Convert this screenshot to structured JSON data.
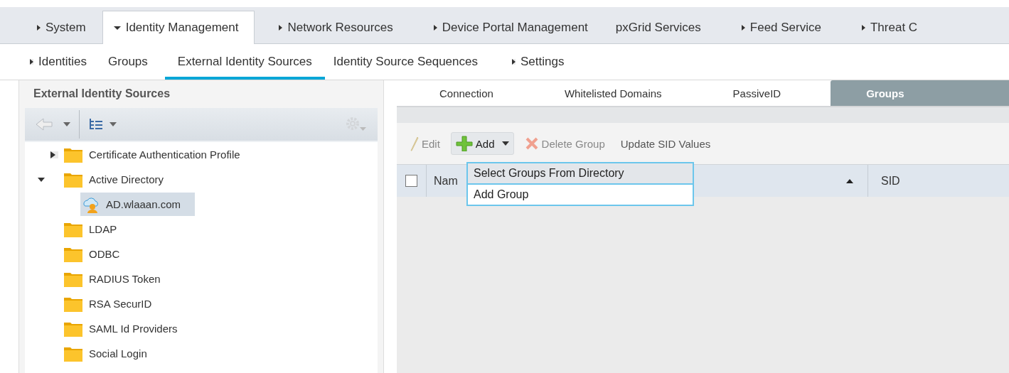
{
  "top_tabs": [
    {
      "label": "System",
      "has_menu": true,
      "selected": false
    },
    {
      "label": "Identity Management",
      "has_menu": true,
      "selected": true
    },
    {
      "label": "Network Resources",
      "has_menu": true,
      "selected": false
    },
    {
      "label": "Device Portal Management",
      "has_menu": true,
      "selected": false
    },
    {
      "label": "pxGrid Services",
      "has_menu": false,
      "selected": false
    },
    {
      "label": "Feed Service",
      "has_menu": true,
      "selected": false
    },
    {
      "label": "Threat C",
      "has_menu": true,
      "selected": false
    }
  ],
  "sub_tabs": [
    {
      "label": "Identities",
      "has_menu": true,
      "selected": false
    },
    {
      "label": "Groups",
      "has_menu": false,
      "selected": false
    },
    {
      "label": "External Identity Sources",
      "has_menu": false,
      "selected": true
    },
    {
      "label": "Identity Source Sequences",
      "has_menu": false,
      "selected": false
    },
    {
      "label": "Settings",
      "has_menu": true,
      "selected": false
    }
  ],
  "sidebar": {
    "title": "External Identity Sources",
    "tree": [
      {
        "label": "Certificate Authentication Profile",
        "expanded": false
      },
      {
        "label": "Active Directory",
        "expanded": true,
        "children": [
          {
            "label": "AD.wlaaan.com",
            "kind": "domain",
            "selected": true
          }
        ]
      },
      {
        "label": "LDAP"
      },
      {
        "label": "ODBC"
      },
      {
        "label": "RADIUS Token"
      },
      {
        "label": "RSA SecurID"
      },
      {
        "label": "SAML Id Providers"
      },
      {
        "label": "Social Login"
      }
    ]
  },
  "panel_tabs": [
    {
      "label": "Connection",
      "selected": false
    },
    {
      "label": "Whitelisted Domains",
      "selected": false
    },
    {
      "label": "PassiveID",
      "selected": false
    },
    {
      "label": "Groups",
      "selected": true
    }
  ],
  "toolbar": [
    {
      "kind": "edit",
      "label": "Edit",
      "disabled": true
    },
    {
      "kind": "add",
      "label": "Add",
      "disabled": false,
      "expanded": true
    },
    {
      "kind": "delete",
      "label": "Delete Group",
      "disabled": true
    },
    {
      "kind": "plain",
      "label": "Update SID Values",
      "disabled": false
    }
  ],
  "add_menu": [
    {
      "label": "Select Groups From Directory",
      "selected": true
    },
    {
      "label": "Add Group",
      "selected": false
    }
  ],
  "table": {
    "select_all_checked": false,
    "columns": [
      {
        "label": "Nam",
        "sorted": true
      },
      {
        "label": "SID"
      }
    ]
  }
}
